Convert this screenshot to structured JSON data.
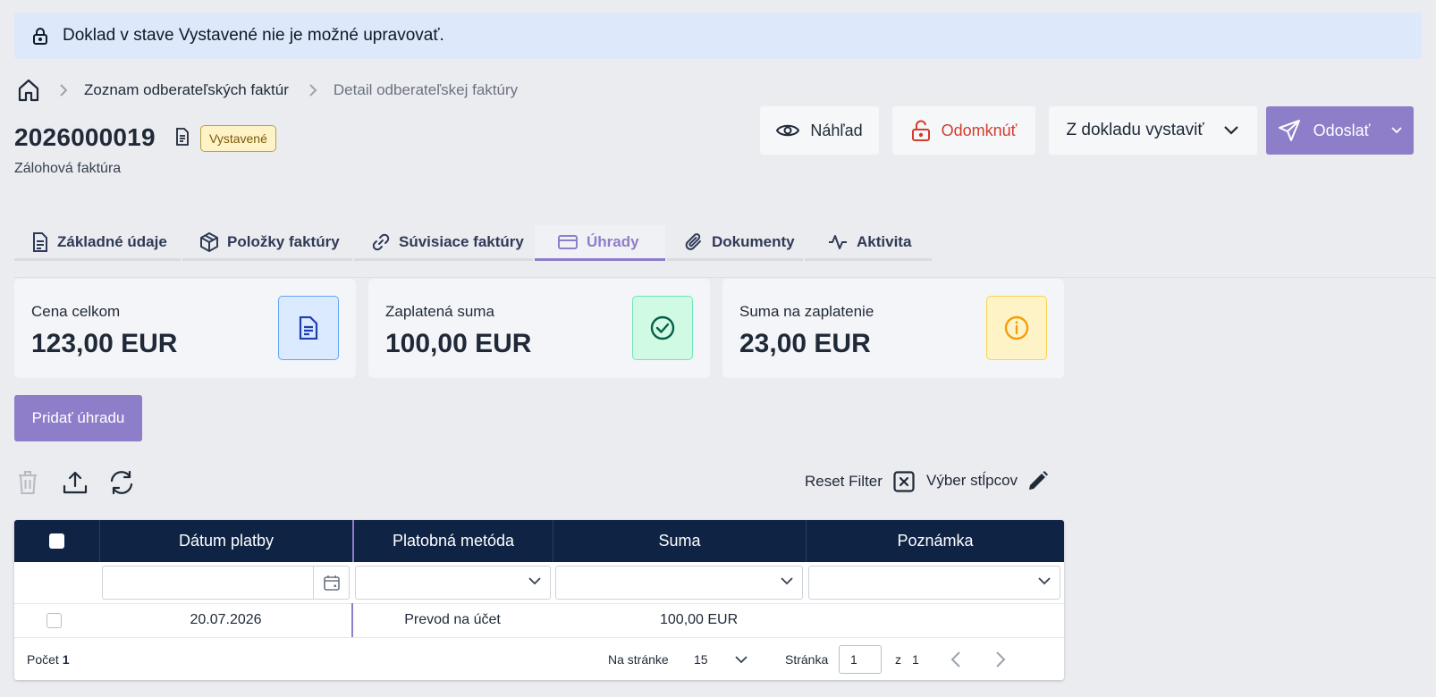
{
  "notice": {
    "text": "Doklad v stave Vystavené nie je možné upravovať."
  },
  "breadcrumb": {
    "items": [
      "Zoznam odberateľských faktúr",
      "Detail odberateľskej faktúry"
    ]
  },
  "document": {
    "number": "2026000019",
    "status": "Vystavené",
    "type": "Zálohová faktúra"
  },
  "actions": {
    "preview": "Náhľad",
    "unlock": "Odomknúť",
    "issue_from": "Z dokladu vystaviť",
    "send": "Odoslať"
  },
  "tabs": [
    {
      "label": "Základné údaje",
      "icon": "document-icon"
    },
    {
      "label": "Položky faktúry",
      "icon": "package-icon"
    },
    {
      "label": "Súvisiace faktúry",
      "icon": "link-icon"
    },
    {
      "label": "Úhrady",
      "icon": "credit-card-icon",
      "active": true
    },
    {
      "label": "Dokumenty",
      "icon": "paperclip-icon"
    },
    {
      "label": "Aktivita",
      "icon": "activity-icon"
    }
  ],
  "summary": [
    {
      "label": "Cena celkom",
      "value": "123,00 EUR",
      "icon": "document-icon",
      "color": "#1e40af"
    },
    {
      "label": "Zaplatená suma",
      "value": "100,00 EUR",
      "icon": "check-circle-icon",
      "color": "#065f46"
    },
    {
      "label": "Suma na zaplatenie",
      "value": "23,00 EUR",
      "icon": "info-circle-icon",
      "color": "#f59e0b"
    }
  ],
  "add_payment": "Pridať úhradu",
  "toolbar": {
    "reset_filter": "Reset Filter",
    "columns": "Výber stĺpcov"
  },
  "grid": {
    "columns": [
      "Dátum platby",
      "Platobná metóda",
      "Suma",
      "Poznámka"
    ],
    "rows": [
      {
        "date": "20.07.2026",
        "method": "Prevod na účet",
        "amount": "100,00 EUR",
        "note": ""
      }
    ],
    "footer": {
      "count_label": "Počet",
      "count": "1",
      "per_page_label": "Na stránke",
      "per_page": "15",
      "page_label": "Stránka",
      "page": "1",
      "of_label": "z",
      "total_pages": "1"
    }
  },
  "colors": {
    "accent": "#8e7ec9",
    "header_bg": "#0f2344",
    "notice_bg": "#dde9fb",
    "danger": "#d43b2b"
  }
}
